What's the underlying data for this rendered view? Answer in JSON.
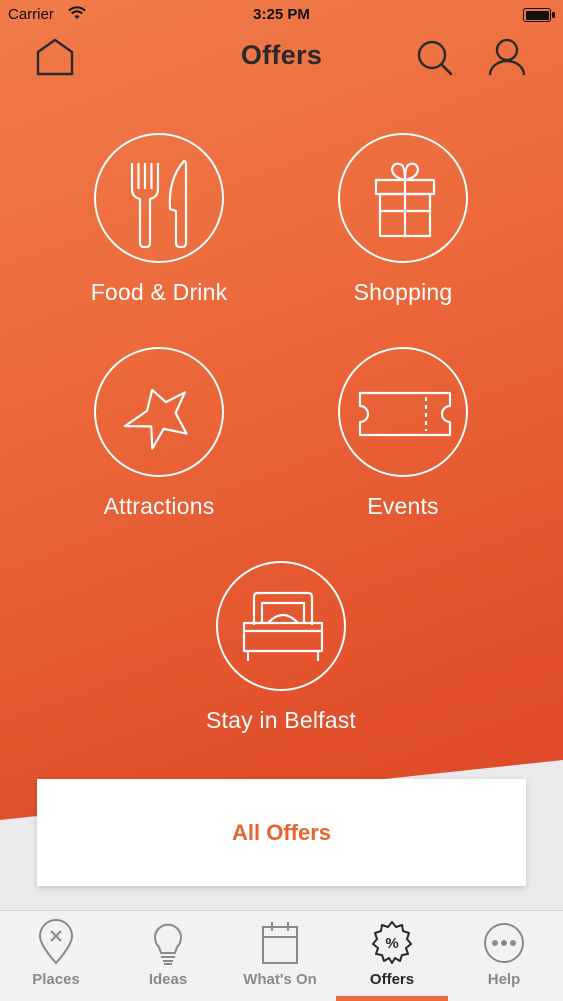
{
  "status_bar": {
    "carrier": "Carrier",
    "time": "3:25 PM"
  },
  "header": {
    "title": "Offers",
    "left_icon": "home-icon",
    "right_icons": [
      "search-icon",
      "profile-icon"
    ]
  },
  "categories": [
    {
      "label": "Food & Drink",
      "icon": "fork-knife-icon"
    },
    {
      "label": "Shopping",
      "icon": "gift-icon"
    },
    {
      "label": "Attractions",
      "icon": "star-icon"
    },
    {
      "label": "Events",
      "icon": "ticket-icon"
    },
    {
      "label": "Stay in Belfast",
      "icon": "bed-icon"
    }
  ],
  "all_offers": {
    "label": "All Offers"
  },
  "tabbar": {
    "active": "Offers",
    "tabs": [
      {
        "label": "Places",
        "icon": "map-pin-icon"
      },
      {
        "label": "Ideas",
        "icon": "lightbulb-icon"
      },
      {
        "label": "What's On",
        "icon": "calendar-icon"
      },
      {
        "label": "Offers",
        "icon": "offer-badge-icon"
      },
      {
        "label": "Help",
        "icon": "more-icon"
      }
    ]
  },
  "colors": {
    "accent": "#ec6a3c",
    "accent_text": "#e8642f",
    "tab_inactive": "#8a8a8a"
  }
}
